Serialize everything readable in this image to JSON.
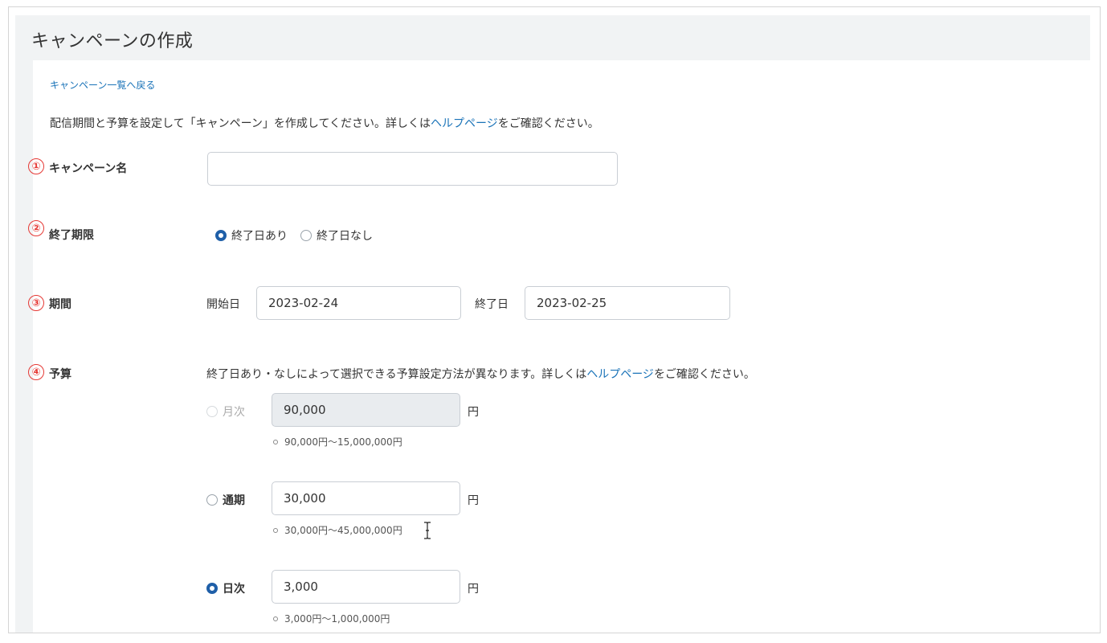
{
  "page": {
    "title": "キャンペーンの作成",
    "back_link": "キャンペーン一覧へ戻る",
    "intro_before": "配信期間と予算を設定して「キャンペーン」を作成してください。詳しくは",
    "intro_link": "ヘルプページ",
    "intro_after": "をご確認ください。"
  },
  "steps": [
    "①",
    "②",
    "③",
    "④"
  ],
  "campaign_name": {
    "label": "キャンペーン名",
    "value": ""
  },
  "end_limit": {
    "label": "終了期限",
    "options": [
      {
        "label": "終了日あり",
        "checked": true
      },
      {
        "label": "終了日なし",
        "checked": false
      }
    ]
  },
  "period": {
    "label": "期間",
    "start_label": "開始日",
    "start_value": "2023-02-24",
    "end_label": "終了日",
    "end_value": "2023-02-25"
  },
  "budget": {
    "label": "予算",
    "note_before": "終了日あり・なしによって選択できる予算設定方法が異なります。詳しくは",
    "note_link": "ヘルプページ",
    "note_after": "をご確認ください。",
    "currency": "円",
    "options": [
      {
        "label": "月次",
        "value": "90,000",
        "range": "90,000円～15,000,000円",
        "checked": false,
        "disabled": true
      },
      {
        "label": "通期",
        "value": "30,000",
        "range": "30,000円～45,000,000円",
        "checked": false,
        "disabled": false
      },
      {
        "label": "日次",
        "value": "3,000",
        "range": "3,000円～1,000,000円",
        "checked": true,
        "disabled": false
      }
    ]
  },
  "colors": {
    "accent": "#1f5fa8",
    "link": "#1a73b8",
    "step_marker": "#e53935",
    "title_bar": "#f1f3f4"
  }
}
